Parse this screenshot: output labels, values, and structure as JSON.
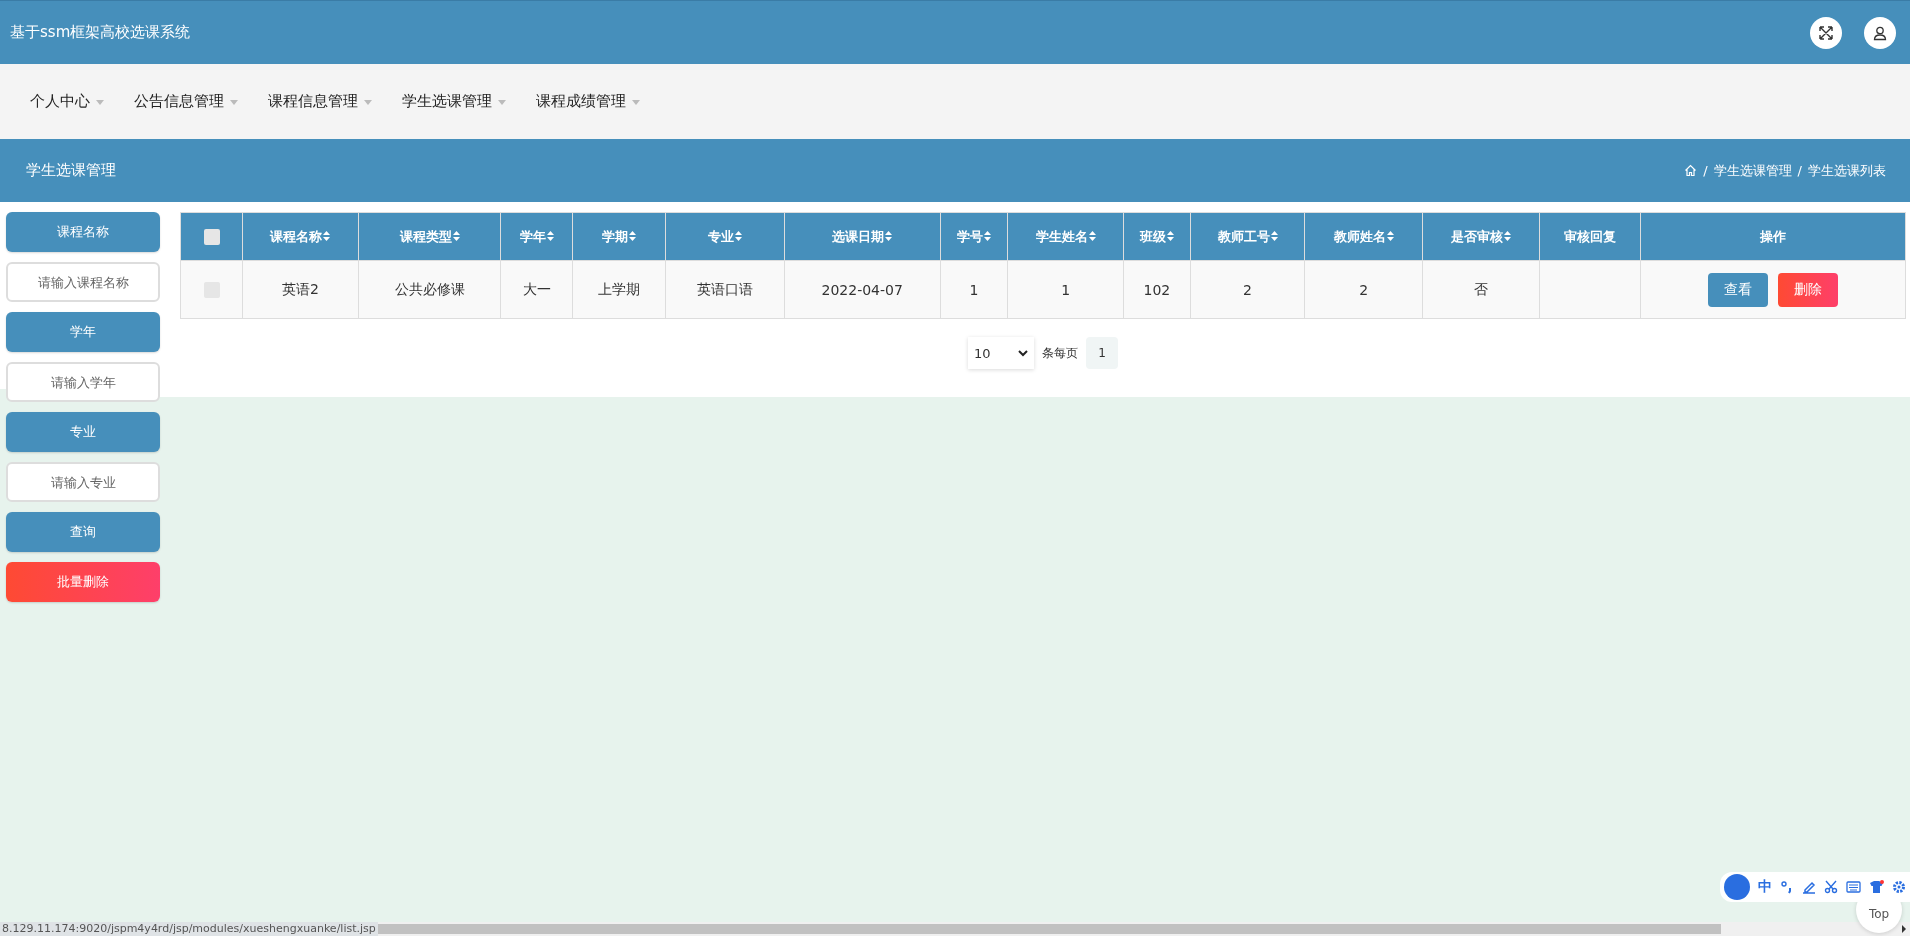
{
  "header": {
    "title": "基于ssm框架高校选课系统"
  },
  "nav": [
    {
      "label": "个人中心"
    },
    {
      "label": "公告信息管理"
    },
    {
      "label": "课程信息管理"
    },
    {
      "label": "学生选课管理"
    },
    {
      "label": "课程成绩管理"
    }
  ],
  "breadcrumb_bar": {
    "title": "学生选课管理",
    "crumbs": [
      "学生选课管理",
      "学生选课列表"
    ],
    "separator": "/"
  },
  "sidebar": [
    {
      "kind": "label",
      "text": "课程名称"
    },
    {
      "kind": "input",
      "placeholder": "请输入课程名称"
    },
    {
      "kind": "label",
      "text": "学年"
    },
    {
      "kind": "input",
      "placeholder": "请输入学年"
    },
    {
      "kind": "label",
      "text": "专业"
    },
    {
      "kind": "input",
      "placeholder": "请输入专业"
    },
    {
      "kind": "search",
      "text": "查询"
    },
    {
      "kind": "danger",
      "text": "批量删除"
    }
  ],
  "table": {
    "select_all": {
      "checked": false
    },
    "columns": [
      {
        "label": "课程名称",
        "sortable": true
      },
      {
        "label": "课程类型",
        "sortable": true
      },
      {
        "label": "学年",
        "sortable": true
      },
      {
        "label": "学期",
        "sortable": true
      },
      {
        "label": "专业",
        "sortable": true
      },
      {
        "label": "选课日期",
        "sortable": true
      },
      {
        "label": "学号",
        "sortable": true
      },
      {
        "label": "学生姓名",
        "sortable": true
      },
      {
        "label": "班级",
        "sortable": true
      },
      {
        "label": "教师工号",
        "sortable": true
      },
      {
        "label": "教师姓名",
        "sortable": true
      },
      {
        "label": "是否审核",
        "sortable": true
      },
      {
        "label": "审核回复",
        "sortable": false
      },
      {
        "label": "操作",
        "sortable": false
      }
    ],
    "rows": [
      {
        "checked": false,
        "cells": [
          "英语2",
          "公共必修课",
          "大一",
          "上学期",
          "英语口语",
          "2022-04-07",
          "1",
          "1",
          "102",
          "2",
          "2",
          "否",
          ""
        ],
        "actions": [
          {
            "kind": "view",
            "label": "查看"
          },
          {
            "kind": "delete",
            "label": "删除"
          }
        ]
      }
    ]
  },
  "pagination": {
    "page_size": "10",
    "page_size_label": "条每页",
    "pages": [
      {
        "label": "1",
        "selected": true
      }
    ]
  },
  "top_button": {
    "label": "Top"
  },
  "ime_toolbar": {
    "mode": "中"
  },
  "status_bar": {
    "url": "8.129.11.174:9020/jspm4y4rd/jsp/modules/xueshengxuanke/list.jsp"
  }
}
